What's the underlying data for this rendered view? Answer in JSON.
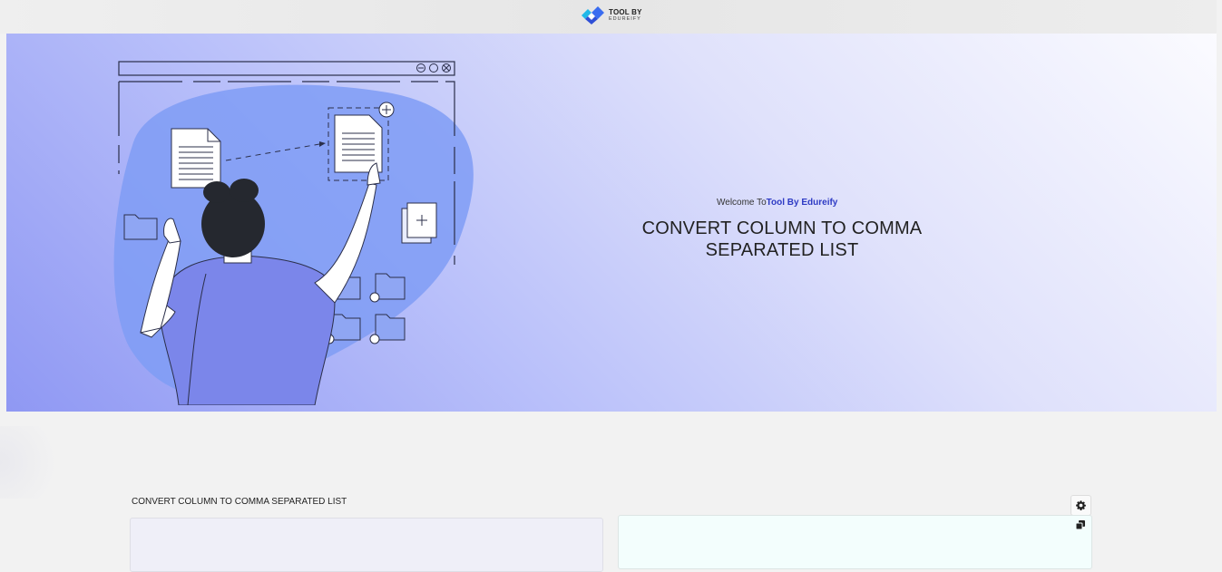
{
  "header": {
    "logo_line1": "TOOL BY",
    "logo_line2": "EDUREIFY"
  },
  "hero": {
    "welcome_prefix": "Welcome To",
    "welcome_brand": "Tool By Edureify",
    "title_line1": "CONVERT COLUMN TO COMMA",
    "title_line2": "SEPARATED LIST"
  },
  "tool": {
    "section_label": "CONVERT COLUMN TO COMMA SEPARATED LIST",
    "input_value": "",
    "output_value": ""
  },
  "icons": {
    "logo": "edureify-logo-icon",
    "settings": "gear-icon",
    "copy": "copy-icon"
  },
  "colors": {
    "brand_link": "#2d3ac4",
    "hero_start": "#8f98f3",
    "hero_end": "#fbfbff"
  }
}
